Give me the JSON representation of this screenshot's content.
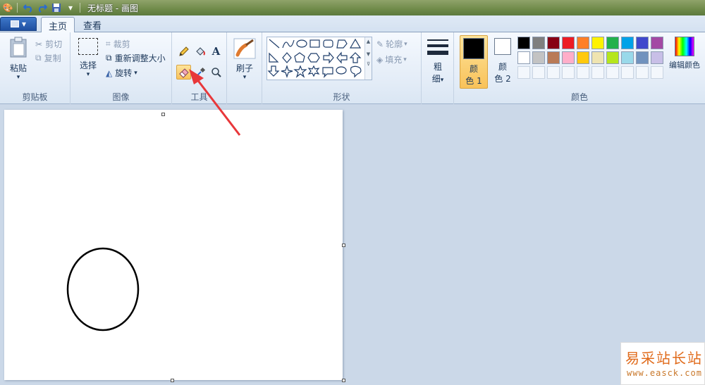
{
  "window": {
    "title": "无标题 - 画图"
  },
  "tabs": [
    {
      "label": "主页",
      "active": true
    },
    {
      "label": "查看",
      "active": false
    }
  ],
  "ribbon": {
    "clipboard": {
      "label": "剪贴板",
      "paste": "粘贴",
      "cut": "剪切",
      "copy": "复制"
    },
    "image": {
      "label": "图像",
      "select": "选择",
      "crop": "裁剪",
      "resize": "重新调整大小",
      "rotate": "旋转"
    },
    "tools": {
      "label": "工具",
      "items": [
        "pencil-icon",
        "fill-icon",
        "text-icon",
        "eraser-icon",
        "color-picker-icon",
        "magnifier-icon"
      ],
      "selected": "eraser-icon"
    },
    "brushes": {
      "label": "刷子"
    },
    "shapes": {
      "label": "形状",
      "outline": "轮廓",
      "fill": "填充"
    },
    "size": {
      "label_line1": "粗",
      "label_line2": "细"
    },
    "colors": {
      "label": "颜色",
      "color1_line1": "颜",
      "color1_line2": "色 1",
      "color2_line1": "颜",
      "color2_line2": "色 2",
      "color1_value": "#000000",
      "color2_value": "#ffffff",
      "edit": "编辑颜色",
      "palette_row1": [
        "#000000",
        "#7f7f7f",
        "#880015",
        "#ed1c24",
        "#ff7f27",
        "#fff200",
        "#22b14c",
        "#00a2e8",
        "#3f48cc",
        "#a349a4"
      ],
      "palette_row2": [
        "#ffffff",
        "#c3c3c3",
        "#b97a57",
        "#ffaec9",
        "#ffc90e",
        "#efe4b0",
        "#b5e61d",
        "#99d9ea",
        "#7092be",
        "#c8bfe7"
      ]
    }
  },
  "watermark": {
    "text": "易采站长站",
    "url": "www.easck.com"
  },
  "colors": {
    "arrow": "#e8373a",
    "selected_tool": "#f9c25a",
    "title_bar": "#6f8a49"
  }
}
